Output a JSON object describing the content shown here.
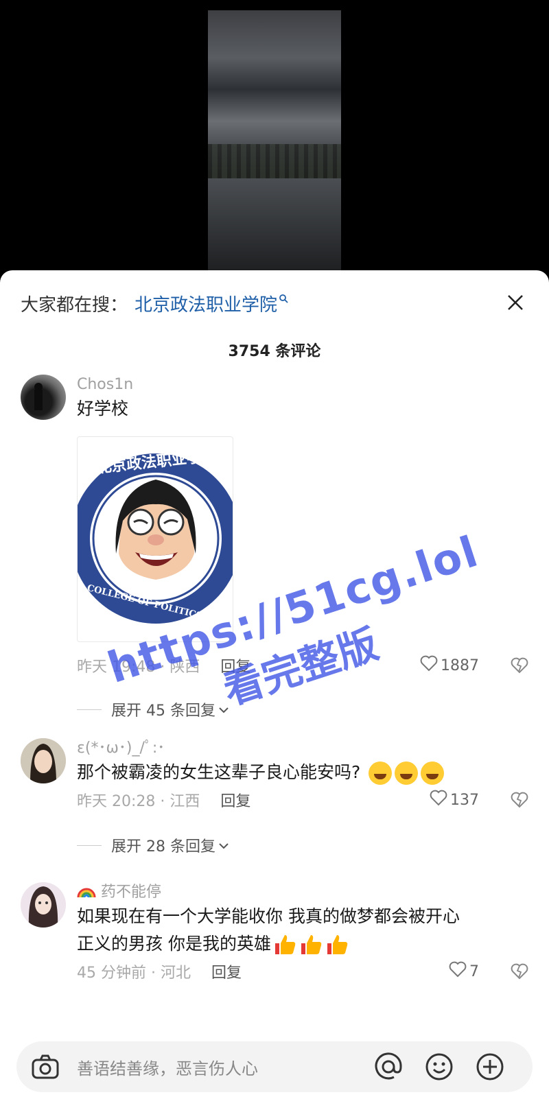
{
  "search": {
    "prefix": "大家都在搜：",
    "term": "北京政法职业学院"
  },
  "comment_count": "3754 条评论",
  "comments": [
    {
      "username": "Chos1n",
      "text": "好学校",
      "time_location": "昨天 19:48 · 陕西",
      "reply_label": "回复",
      "likes": "1887",
      "expand_label": "展开 45 条回复",
      "sticker_text": "北京政法职业学院",
      "sticker_text_en": "COLLEGE OF POLITICS AND"
    },
    {
      "username": "ε(*･ω･)_/ﾟ:･",
      "text": "那个被霸凌的女生这辈子良心能安吗?",
      "time_location": "昨天 20:28 · 江西",
      "reply_label": "回复",
      "likes": "137",
      "expand_label": "展开 28 条回复"
    },
    {
      "username": "药不能停",
      "text_line1": "如果现在有一个大学能收你 我真的做梦都会被开心",
      "text_line2": "正义的男孩 你是我的英雄",
      "time_location": "45 分钟前 · 河北",
      "reply_label": "回复",
      "likes": "7"
    }
  ],
  "input": {
    "placeholder": "善语结善缘，恶言伤人心"
  },
  "watermark": {
    "line1": "https://51cg.lol",
    "line2": "看完整版"
  },
  "colors": {
    "link_blue": "#1f5fa8",
    "watermark": "#465ae6",
    "meta_gray": "#a8a8a8"
  }
}
